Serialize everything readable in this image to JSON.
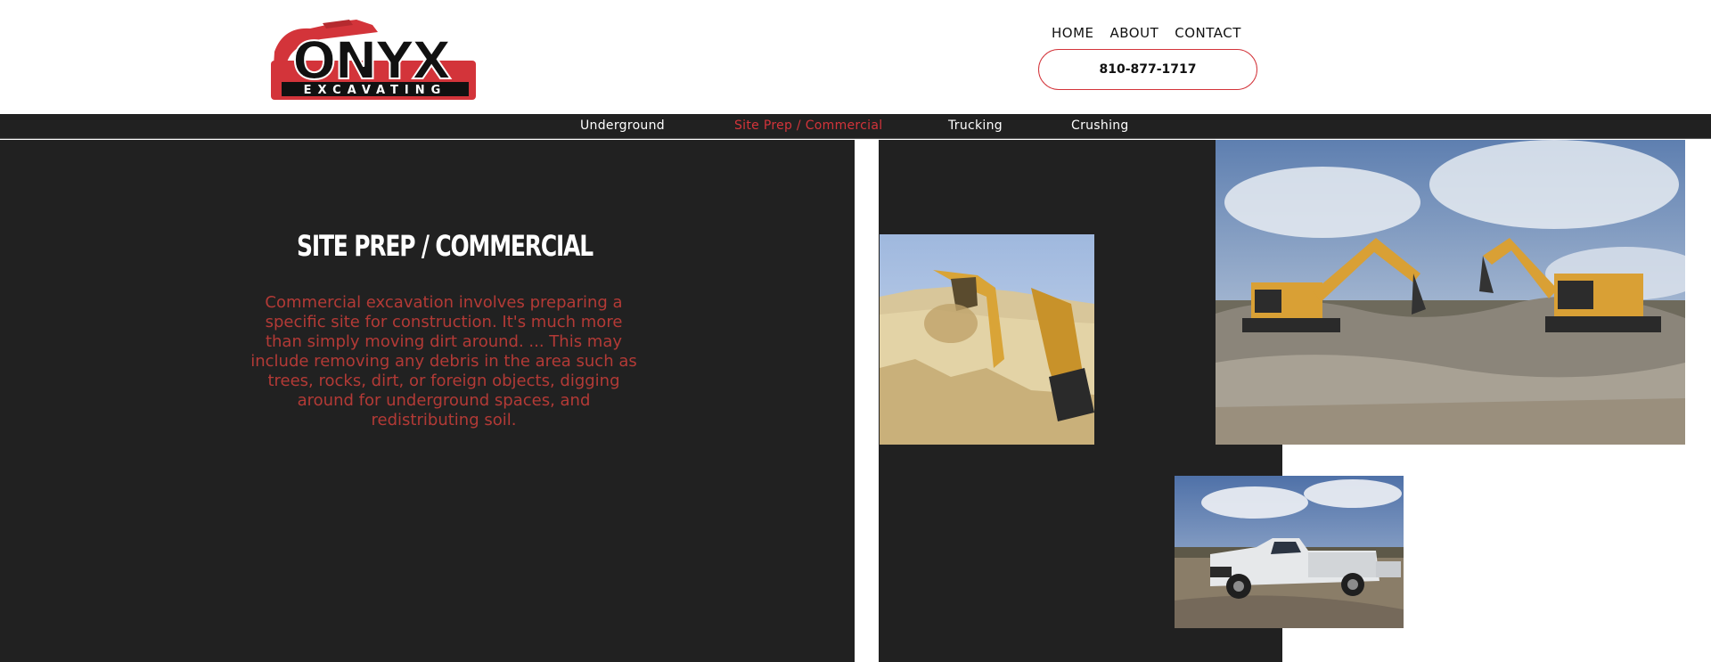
{
  "brand": {
    "logo_wordmark": "ONYX",
    "logo_subtitle": "EXCAVATING"
  },
  "topnav": {
    "items": [
      {
        "label": "HOME"
      },
      {
        "label": "ABOUT"
      },
      {
        "label": "CONTACT"
      }
    ],
    "phone": "810-877-1717"
  },
  "subnav": {
    "items": [
      {
        "label": "Underground"
      },
      {
        "label": "Site Prep / Commercial"
      },
      {
        "label": "Trucking"
      },
      {
        "label": "Crushing"
      }
    ]
  },
  "main": {
    "title": "SITE PREP / COMMERCIAL",
    "description": "Commercial excavation involves preparing a specific site for construction. It's much more than simply moving dirt around. ... This may include removing any debris in the area such as trees, rocks, dirt, or foreign objects, digging around for underground spaces, and redistributing soil."
  },
  "colors": {
    "accent": "#d3343a",
    "dark_panel": "#212121",
    "description_text": "#b33a36"
  }
}
